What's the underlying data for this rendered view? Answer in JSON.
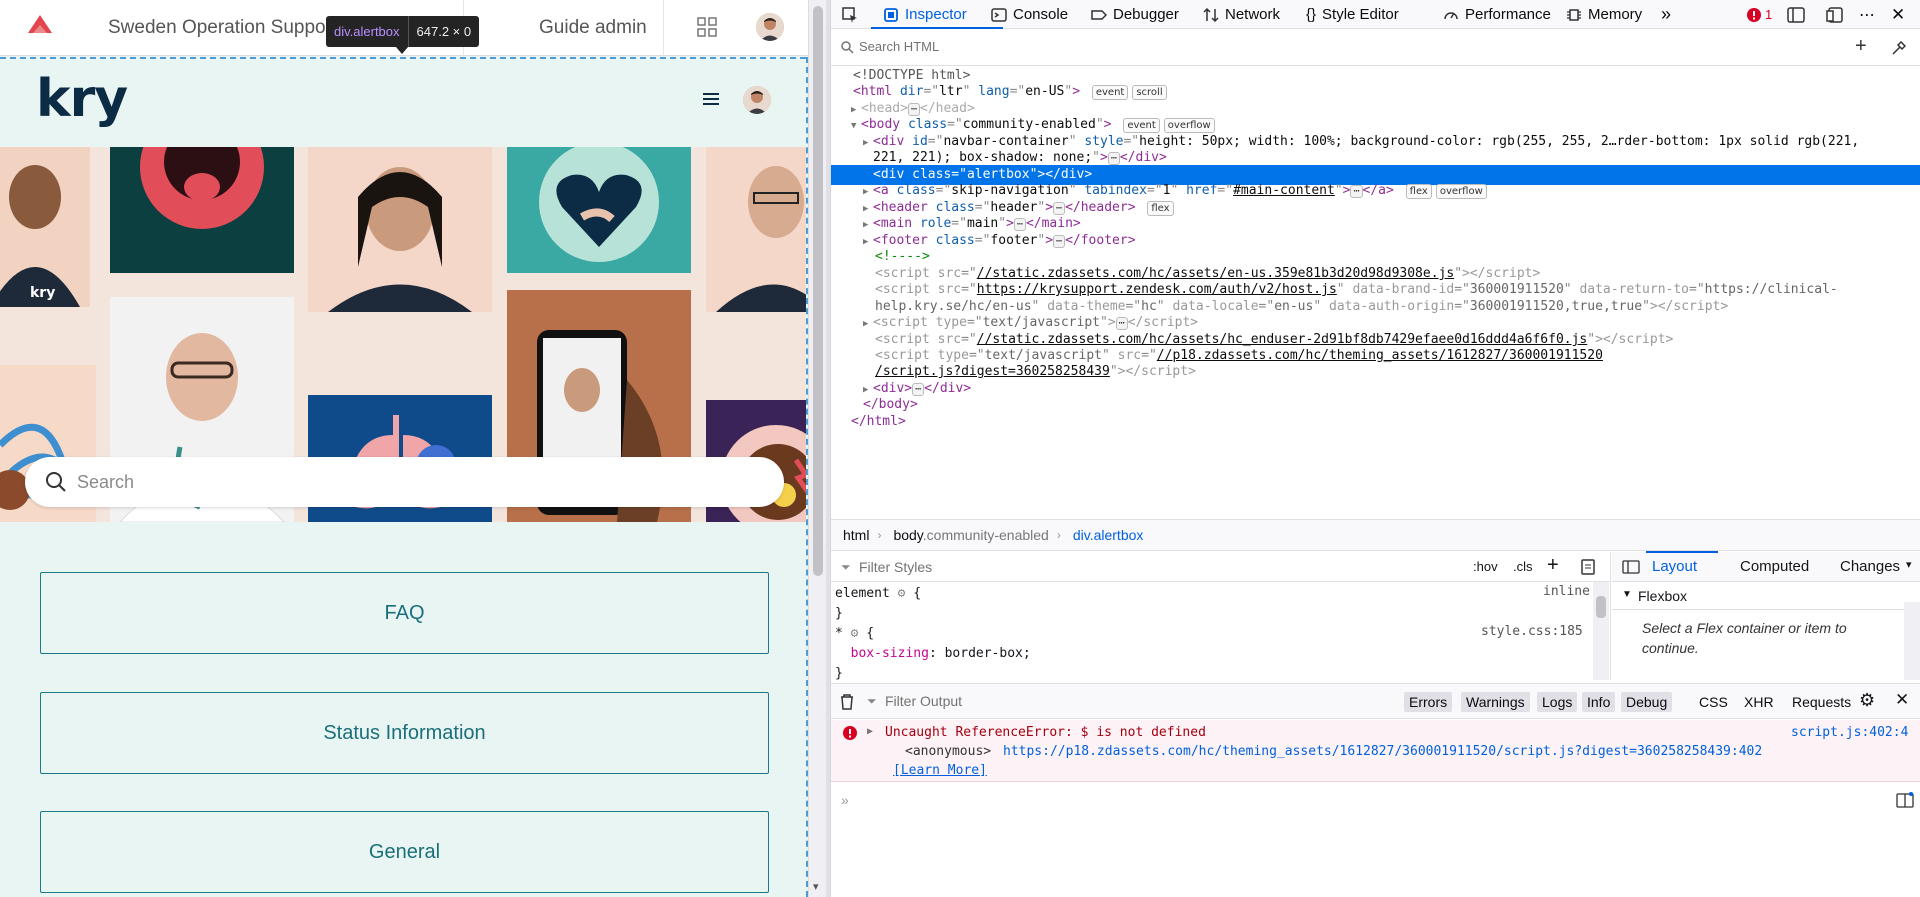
{
  "page": {
    "nav": {
      "brand": "Sweden Operation Support",
      "guide_admin": "Guide admin"
    },
    "tooltip": {
      "selector": "div.alertbox",
      "dimensions": "647.2 × 0"
    },
    "kry_logo": "kry",
    "search_placeholder": "Search",
    "categories": [
      "FAQ",
      "Status Information",
      "General"
    ]
  },
  "devtools": {
    "tabs": {
      "inspector": "Inspector",
      "console": "Console",
      "debugger": "Debugger",
      "network": "Network",
      "style_editor": "Style Editor",
      "performance": "Performance",
      "memory": "Memory"
    },
    "error_count": "1",
    "search_placeholder": "Search HTML",
    "markup": {
      "doctype": "<!DOCTYPE html>",
      "html_open_attrs": {
        "dir": "ltr",
        "lang": "en-US"
      },
      "head": "head",
      "body_class": "community-enabled",
      "navbar_id": "navbar-container",
      "navbar_style_1": "height: 50px; width: 100%; background-color: rgb(255, 255, 2…rder-bottom: 1px solid rgb(221,",
      "navbar_style_2": "221, 221); box-shadow: none;",
      "alertbox_class": "alertbox",
      "skip_class": "skip-navigation",
      "skip_tabindex": "1",
      "skip_href": "#main-content",
      "header_class": "header",
      "main_role": "main",
      "footer_class": "footer",
      "comment": "<!---->",
      "script1_src": "//static.zdassets.com/hc/assets/en-us.359e81b3d20d98d9308e.js",
      "script2_src": "https://krysupport.zendesk.com/auth/v2/host.js",
      "script2_brand": "360001911520",
      "script2_return": "https://clinical-",
      "script2_line2_return": "help.kry.se/hc/en-us",
      "script2_theme": "hc",
      "script2_locale": "en-us",
      "script2_auth": "360001911520,true,true",
      "script3_type": "text/javascript",
      "script4_src": "//static.zdassets.com/hc/assets/hc_enduser-2d91bf8db7429efaee0d16ddd4a6f6f0.js",
      "script5_type": "text/javascript",
      "script5_src_1": "//p18.zdassets.com/hc/theming_assets/1612827/360001911520",
      "script5_src_2": "/script.js?digest=360258258439",
      "badges": {
        "event": "event",
        "scroll": "scroll",
        "overflow": "overflow",
        "flex": "flex"
      }
    },
    "breadcrumbs": [
      "html",
      "body",
      ".community-enabled",
      "div.alertbox"
    ],
    "rules": {
      "filter_placeholder": "Filter Styles",
      "hov": ":hov",
      "cls": ".cls",
      "element_selector": "element",
      "element_source": "inline",
      "star_selector": "*",
      "star_source": "style.css:185",
      "prop_name": "box-sizing",
      "prop_value": "border-box"
    },
    "layout_tabs": [
      "Layout",
      "Computed",
      "Changes"
    ],
    "flexbox_title": "Flexbox",
    "flexbox_msg": "Select a Flex container or item to continue.",
    "console": {
      "filter_placeholder": "Filter Output",
      "filters": [
        "Errors",
        "Warnings",
        "Logs",
        "Info",
        "Debug"
      ],
      "filters2": [
        "CSS",
        "XHR",
        "Requests"
      ],
      "error_message": "Uncaught ReferenceError: $ is not defined",
      "error_source": "script.js:402:4",
      "error_frame": "<anonymous>",
      "error_url": "https://p18.zdassets.com/hc/theming_assets/1612827/360001911520/script.js?digest=360258258439:402",
      "learn_more": "[Learn More]"
    }
  },
  "colors": {
    "accent": "#0060df",
    "page_bg": "#e9f5f2",
    "button_border": "#1a7a87",
    "kry_navy": "#0c2b45",
    "error": "#d70022"
  }
}
